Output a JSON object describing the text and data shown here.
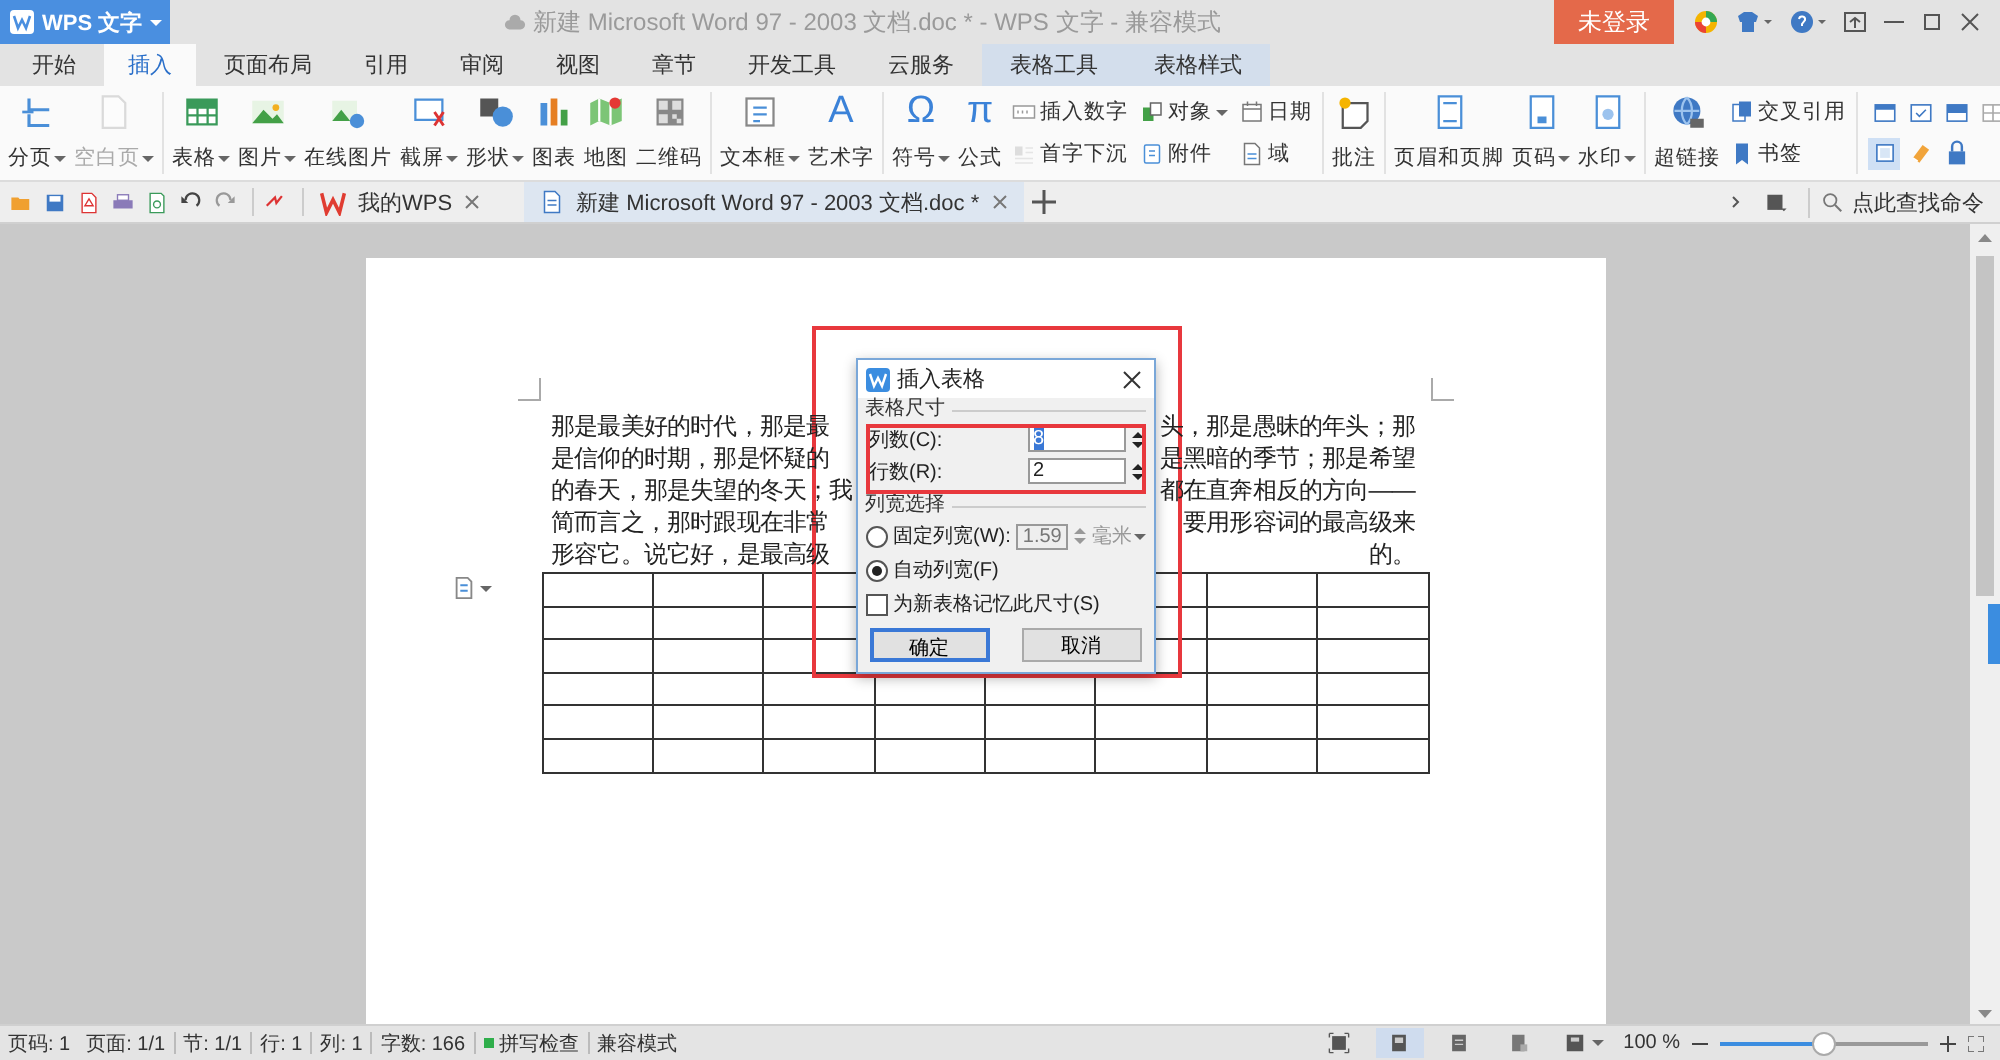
{
  "window": {
    "app_menu": "WPS 文字",
    "title": "新建 Microsoft Word 97 - 2003 文档.doc * - WPS 文字 - 兼容模式",
    "login_button": "未登录"
  },
  "ribbon_tabs": [
    {
      "label": "开始",
      "selected": false,
      "kind": "main"
    },
    {
      "label": "插入",
      "selected": true,
      "kind": "main"
    },
    {
      "label": "页面布局",
      "selected": false,
      "kind": "main"
    },
    {
      "label": "引用",
      "selected": false,
      "kind": "main"
    },
    {
      "label": "审阅",
      "selected": false,
      "kind": "main"
    },
    {
      "label": "视图",
      "selected": false,
      "kind": "main"
    },
    {
      "label": "章节",
      "selected": false,
      "kind": "main"
    },
    {
      "label": "开发工具",
      "selected": false,
      "kind": "main"
    },
    {
      "label": "云服务",
      "selected": false,
      "kind": "main"
    },
    {
      "label": "表格工具",
      "selected": false,
      "kind": "context"
    },
    {
      "label": "表格样式",
      "selected": false,
      "kind": "context"
    }
  ],
  "ribbon": {
    "groups": [
      {
        "items": [
          {
            "kind": "large",
            "label": "分页",
            "dropdown": true,
            "disabled": false
          },
          {
            "kind": "large",
            "label": "空白页",
            "dropdown": true,
            "disabled": true
          }
        ]
      },
      {
        "items": [
          {
            "kind": "large",
            "label": "表格",
            "dropdown": true,
            "disabled": false
          },
          {
            "kind": "large",
            "label": "图片",
            "dropdown": true,
            "disabled": false
          },
          {
            "kind": "large",
            "label": "在线图片",
            "dropdown": false,
            "disabled": false
          },
          {
            "kind": "large",
            "label": "截屏",
            "dropdown": true,
            "disabled": false
          },
          {
            "kind": "large",
            "label": "形状",
            "dropdown": true,
            "disabled": false
          },
          {
            "kind": "large",
            "label": "图表",
            "dropdown": false,
            "disabled": false
          },
          {
            "kind": "large",
            "label": "地图",
            "dropdown": false,
            "disabled": false
          },
          {
            "kind": "large",
            "label": "二维码",
            "dropdown": false,
            "disabled": false
          }
        ]
      },
      {
        "items": [
          {
            "kind": "large",
            "label": "文本框",
            "dropdown": true,
            "disabled": false
          },
          {
            "kind": "large",
            "label": "艺术字",
            "glyph": "A",
            "dropdown": false,
            "disabled": false
          }
        ]
      },
      {
        "items": [
          {
            "kind": "large",
            "label": "符号",
            "glyph": "Ω",
            "dropdown": true,
            "disabled": false
          },
          {
            "kind": "large",
            "label": "公式",
            "glyph": "π",
            "dropdown": false,
            "disabled": false
          },
          {
            "kind": "column",
            "rows": [
              {
                "label": "插入数字",
                "dropdown": false,
                "disabled": false
              },
              {
                "label": "首字下沉",
                "dropdown": false,
                "disabled": true
              }
            ]
          },
          {
            "kind": "column",
            "rows": [
              {
                "label": "对象",
                "dropdown": true,
                "disabled": false
              },
              {
                "label": "附件",
                "dropdown": false,
                "disabled": false
              }
            ]
          },
          {
            "kind": "column",
            "rows": [
              {
                "label": "日期",
                "dropdown": false,
                "disabled": false
              },
              {
                "label": "域",
                "dropdown": false,
                "disabled": false
              }
            ]
          }
        ]
      },
      {
        "items": [
          {
            "kind": "large",
            "label": "批注",
            "dropdown": false,
            "disabled": false
          }
        ]
      },
      {
        "items": [
          {
            "kind": "large",
            "label": "页眉和页脚",
            "dropdown": false,
            "disabled": false
          },
          {
            "kind": "large",
            "label": "页码",
            "dropdown": true,
            "disabled": false
          },
          {
            "kind": "large",
            "label": "水印",
            "dropdown": true,
            "disabled": false
          }
        ]
      },
      {
        "items": [
          {
            "kind": "large",
            "label": "超链接",
            "dropdown": false,
            "disabled": false
          },
          {
            "kind": "column",
            "rows": [
              {
                "label": "交叉引用",
                "dropdown": false,
                "disabled": false
              },
              {
                "label": "书签",
                "dropdown": false,
                "disabled": false
              }
            ]
          }
        ]
      },
      {
        "items": [
          {
            "kind": "grid",
            "buttons": [
              {
                "selected": false
              },
              {
                "selected": false
              },
              {
                "selected": false
              },
              {
                "selected": false
              },
              {
                "selected": true
              },
              {
                "selected": false
              },
              {
                "selected": false
              }
            ]
          }
        ]
      }
    ]
  },
  "doc_tabs": [
    {
      "label": "我的WPS",
      "kind": "home",
      "selected": false
    },
    {
      "label": "新建 Microsoft Word 97 - 2003 文档.doc *",
      "kind": "document",
      "selected": true
    }
  ],
  "command_search": {
    "placeholder": "点此查找命令"
  },
  "document": {
    "lines": [
      {
        "left": "那是最美好的时代，那是最",
        "right": "头，那是愚昧的年头；那"
      },
      {
        "left": "是信仰的时期，那是怀疑的",
        "right": "是黑暗的季节；那是希望"
      },
      {
        "left": "的春天，那是失望的冬天；我",
        "right": "都在直奔相反的方向——"
      },
      {
        "left": "简而言之，那时跟现在非常",
        "right": "要用形容词的最高级来"
      },
      {
        "left": "形容它。说它好，是最高级",
        "right": "的。"
      }
    ],
    "table": {
      "rows": [
        {
          "cells": [
            {},
            {},
            {},
            {},
            {},
            {},
            {},
            {}
          ]
        },
        {
          "cells": [
            {},
            {},
            {},
            {},
            {},
            {},
            {},
            {}
          ]
        },
        {
          "cells": [
            {},
            {},
            {},
            {},
            {},
            {},
            {},
            {}
          ]
        },
        {
          "cells": [
            {},
            {},
            {},
            {},
            {},
            {},
            {},
            {}
          ]
        },
        {
          "cells": [
            {},
            {},
            {},
            {},
            {},
            {},
            {},
            {}
          ]
        },
        {
          "cells": [
            {},
            {},
            {},
            {},
            {},
            {},
            {},
            {}
          ]
        }
      ]
    }
  },
  "dialog": {
    "title": "插入表格",
    "size_group": {
      "label": "表格尺寸",
      "fields": [
        {
          "label": "列数(C):",
          "value": "8",
          "focused": true
        },
        {
          "label": "行数(R):",
          "value": "2",
          "focused": false
        }
      ]
    },
    "width_group": {
      "label": "列宽选择",
      "options": [
        {
          "kind": "fixed",
          "label": "固定列宽(W):",
          "selected": false,
          "value": "1.59",
          "unit": "毫米",
          "disabled": true
        },
        {
          "kind": "auto",
          "label": "自动列宽(F)",
          "selected": true
        }
      ]
    },
    "remember": {
      "label": "为新表格记忆此尺寸(S)",
      "checked": false
    },
    "buttons": [
      {
        "label": "确定",
        "default": true
      },
      {
        "label": "取消",
        "default": false
      }
    ]
  },
  "annotations": [
    {
      "kind": "frame"
    },
    {
      "kind": "frame"
    }
  ],
  "status_bar": {
    "items": [
      {
        "kind": "text",
        "label": "页码: 1"
      },
      {
        "kind": "text",
        "label": "页面: 1/1"
      },
      {
        "kind": "text",
        "label": "节: 1/1"
      },
      {
        "kind": "text",
        "label": "行: 1"
      },
      {
        "kind": "text",
        "label": "列: 1"
      },
      {
        "kind": "text",
        "label": "字数: 166"
      },
      {
        "kind": "spell",
        "label": "拼写检查"
      },
      {
        "kind": "text",
        "label": "兼容模式"
      }
    ],
    "views": [
      {
        "selected": false
      },
      {
        "selected": true
      },
      {
        "selected": false
      },
      {
        "selected": false
      }
    ],
    "zoom": {
      "reading": "100 %",
      "level": 0.5
    }
  }
}
